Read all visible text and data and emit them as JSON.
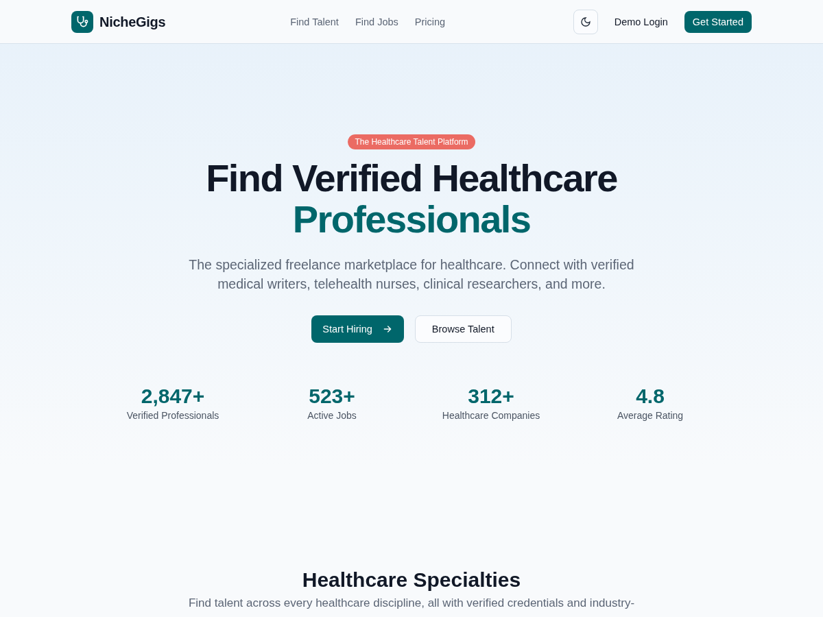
{
  "header": {
    "brand": "NicheGigs",
    "nav": [
      {
        "label": "Find Talent"
      },
      {
        "label": "Find Jobs"
      },
      {
        "label": "Pricing"
      }
    ],
    "demo_login": "Demo Login",
    "get_started": "Get Started"
  },
  "hero": {
    "badge": "The Healthcare Talent Platform",
    "title": "Find Verified Healthcare",
    "title_highlight": "Professionals",
    "subtitle": "The specialized freelance marketplace for healthcare. Connect with verified medical writers, telehealth nurses, clinical researchers, and more.",
    "primary_button": "Start Hiring",
    "secondary_button": "Browse Talent",
    "stats": [
      {
        "value": "2,847+",
        "label": "Verified Professionals"
      },
      {
        "value": "523+",
        "label": "Active Jobs"
      },
      {
        "value": "312+",
        "label": "Healthcare Companies"
      },
      {
        "value": "4.8",
        "label": "Average Rating"
      }
    ]
  },
  "specialties": {
    "title": "Healthcare Specialties",
    "subtitle": "Find talent across every healthcare discipline, all with verified credentials and industry-"
  }
}
